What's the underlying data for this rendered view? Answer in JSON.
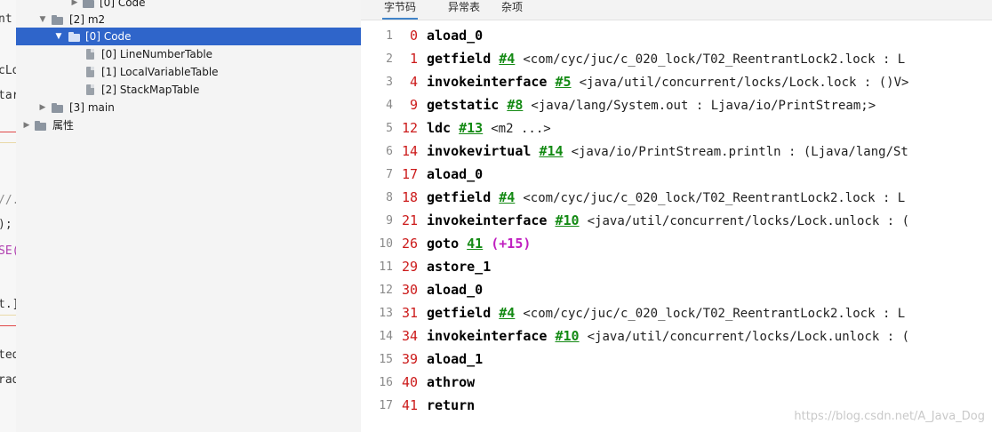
{
  "gutter_fragments": [
    "nt",
    "cLo",
    "tar",
    "//.",
    ");",
    "SE(",
    "t.]",
    "ted",
    "rad"
  ],
  "tree": {
    "rows": [
      {
        "label": "[0] Code",
        "expanded": false,
        "icon": "folder-icon"
      },
      {
        "label": "[2] m2",
        "expanded": true,
        "icon": "folder-icon"
      },
      {
        "label": "[0] Code",
        "expanded": true,
        "icon": "folder-icon",
        "selected": true
      },
      {
        "label": "[0] LineNumberTable",
        "icon": "file-icon"
      },
      {
        "label": "[1] LocalVariableTable",
        "icon": "file-icon"
      },
      {
        "label": "[2] StackMapTable",
        "icon": "file-icon"
      },
      {
        "label": "[3] main",
        "expanded": false,
        "icon": "folder-icon"
      },
      {
        "label": "属性",
        "expanded": false,
        "icon": "folder-icon"
      }
    ]
  },
  "tabs": [
    {
      "label": "字节码",
      "active": true
    },
    {
      "label": "异常表",
      "active": false
    },
    {
      "label": "杂项",
      "active": false
    }
  ],
  "bytecode": [
    {
      "line": "1",
      "offset": "0",
      "op": "aload_0"
    },
    {
      "line": "2",
      "offset": "1",
      "op": "getfield",
      "ref": "#4",
      "desc": "<com/cyc/juc/c_020_lock/T02_ReentrantLock2.lock : L"
    },
    {
      "line": "3",
      "offset": "4",
      "op": "invokeinterface",
      "ref": "#5",
      "desc": "<java/util/concurrent/locks/Lock.lock : ()V>"
    },
    {
      "line": "4",
      "offset": "9",
      "op": "getstatic",
      "ref": "#8",
      "desc": "<java/lang/System.out : Ljava/io/PrintStream;>"
    },
    {
      "line": "5",
      "offset": "12",
      "op": "ldc",
      "ref": "#13",
      "desc": "<m2 ...>"
    },
    {
      "line": "6",
      "offset": "14",
      "op": "invokevirtual",
      "ref": "#14",
      "desc": "<java/io/PrintStream.println : (Ljava/lang/St"
    },
    {
      "line": "7",
      "offset": "17",
      "op": "aload_0"
    },
    {
      "line": "8",
      "offset": "18",
      "op": "getfield",
      "ref": "#4",
      "desc": "<com/cyc/juc/c_020_lock/T02_ReentrantLock2.lock : L"
    },
    {
      "line": "9",
      "offset": "21",
      "op": "invokeinterface",
      "ref": "#10",
      "desc": "<java/util/concurrent/locks/Lock.unlock : ("
    },
    {
      "line": "10",
      "offset": "26",
      "op": "goto",
      "ref": "41",
      "jump": "(+15)"
    },
    {
      "line": "11",
      "offset": "29",
      "op": "astore_1"
    },
    {
      "line": "12",
      "offset": "30",
      "op": "aload_0"
    },
    {
      "line": "13",
      "offset": "31",
      "op": "getfield",
      "ref": "#4",
      "desc": "<com/cyc/juc/c_020_lock/T02_ReentrantLock2.lock : L"
    },
    {
      "line": "14",
      "offset": "34",
      "op": "invokeinterface",
      "ref": "#10",
      "desc": "<java/util/concurrent/locks/Lock.unlock : ("
    },
    {
      "line": "15",
      "offset": "39",
      "op": "aload_1"
    },
    {
      "line": "16",
      "offset": "40",
      "op": "athrow"
    },
    {
      "line": "17",
      "offset": "41",
      "op": "return"
    }
  ],
  "watermark": "https://blog.csdn.net/A_Java_Dog",
  "colors": {
    "selection": "#2f65ca",
    "offset": "#cc1b1b",
    "reference": "#148a14",
    "jump": "#c01fc0"
  }
}
